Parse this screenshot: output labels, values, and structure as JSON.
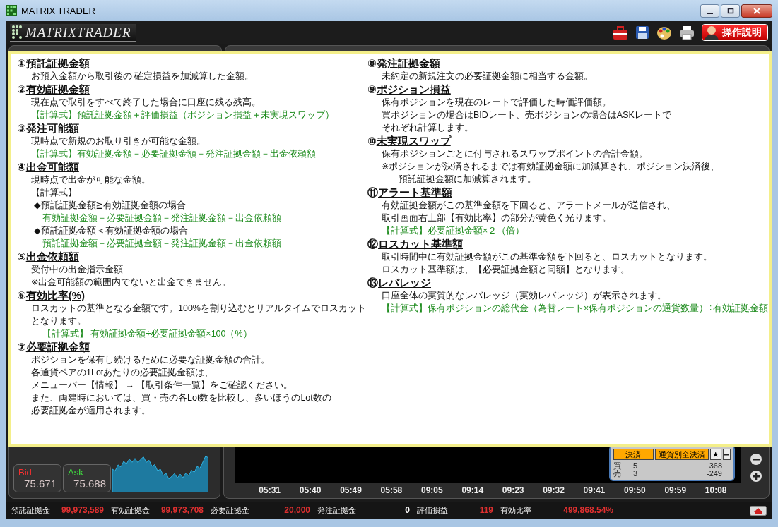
{
  "window": {
    "title": "MATRIX TRADER"
  },
  "header": {
    "logo": "MATRIXTRADER",
    "help_button": "操作説明"
  },
  "help": {
    "columns": [
      [
        {
          "number": "①",
          "title": "預託証拠金額",
          "lines": [
            {
              "kind": "text",
              "text": "お預入金額から取引後の 確定損益を加減算した金額。"
            }
          ]
        },
        {
          "number": "②",
          "title": "有効証拠金額",
          "lines": [
            {
              "kind": "text",
              "text": "現在点で取引をすべて終了した場合に口座に残る残高。"
            },
            {
              "kind": "formula",
              "text": "【計算式】預託証拠金額＋評価損益（ポジション損益＋未実現スワップ）"
            }
          ]
        },
        {
          "number": "③",
          "title": "発注可能額",
          "lines": [
            {
              "kind": "text",
              "text": "現時点で新規のお取り引きが可能な金額。"
            },
            {
              "kind": "formula",
              "text": "【計算式】有効証拠金額－必要証拠金額－発注証拠金額－出金依頼額"
            }
          ]
        },
        {
          "number": "④",
          "title": "出金可能額",
          "lines": [
            {
              "kind": "text",
              "text": "現時点で出金が可能な金額。"
            },
            {
              "kind": "note",
              "text": "【計算式】"
            },
            {
              "kind": "bullet",
              "text": "◆預託証拠金額≧有効証拠金額の場合"
            },
            {
              "kind": "subformula",
              "text": "有効証拠金額－必要証拠金額－発注証拠金額－出金依頼額"
            },
            {
              "kind": "bullet",
              "text": "◆預託証拠金額＜有効証拠金額の場合"
            },
            {
              "kind": "subformula",
              "text": "預託証拠金額－必要証拠金額－発注証拠金額－出金依頼額"
            }
          ]
        },
        {
          "number": "⑤",
          "title": "出金依頼額",
          "lines": [
            {
              "kind": "text",
              "text": "受付中の出金指示金額"
            },
            {
              "kind": "note",
              "text": "※出金可能額の範囲内でないと出金できません。"
            }
          ]
        },
        {
          "number": "⑥",
          "title": "有効比率(%)",
          "lines": [
            {
              "kind": "note",
              "text": "ロスカットの基準となる金額です。100%を割り込むとリアルタイムでロスカット"
            },
            {
              "kind": "note",
              "text": "となります。"
            },
            {
              "kind": "subformula",
              "text": "【計算式】 有効証拠金額÷必要証拠金額×100（%）"
            }
          ]
        },
        {
          "number": "⑦",
          "title": "必要証拠金額",
          "lines": [
            {
              "kind": "text",
              "text": "ポジションを保有し続けるために必要な証拠金額の合計。"
            },
            {
              "kind": "note",
              "text": "各通貨ペアの1Lotあたりの必要証拠金額は、"
            },
            {
              "kind": "note",
              "text": "メニューバー【情報】 → 【取引条件一覧】をご確認ください。"
            },
            {
              "kind": "note",
              "text": "また、両建時においては、買・売の各Lot数を比較し、多いほうのLot数の"
            },
            {
              "kind": "note",
              "text": "必要証拠金が適用されます。"
            }
          ]
        }
      ],
      [
        {
          "number": "⑧",
          "title": "発注証拠金額",
          "lines": [
            {
              "kind": "text",
              "text": "未約定の新規注文の必要証拠金額に相当する金額。"
            }
          ]
        },
        {
          "number": "⑨",
          "title": "ポジション損益",
          "lines": [
            {
              "kind": "text",
              "text": "保有ポジションを現在のレートで評価した時価評価額。"
            },
            {
              "kind": "text",
              "text": "買ポジションの場合はBIDレート、売ポジションの場合はASKレートで"
            },
            {
              "kind": "text",
              "text": "それぞれ計算します。"
            }
          ]
        },
        {
          "number": "⑩",
          "title": "未実現スワップ",
          "lines": [
            {
              "kind": "note",
              "text": "保有ポジションごとに付与されるスワップポイントの合計金額。"
            },
            {
              "kind": "note",
              "text": "※ポジションが決済されるまでは有効証拠金額に加減算され、ポジション決済後、"
            },
            {
              "kind": "continued",
              "text": "預託証拠金額に加減算されます。"
            }
          ]
        },
        {
          "number": "⑪",
          "title": "アラート基準額",
          "lines": [
            {
              "kind": "text",
              "text": "有効証拠金額がこの基準金額を下回ると、アラートメールが送信され、"
            },
            {
              "kind": "note",
              "text": "取引画面右上部【有効比率】の部分が黄色く光ります。"
            },
            {
              "kind": "formula",
              "text": "【計算式】必要証拠金額×２（倍）"
            }
          ]
        },
        {
          "number": "⑫",
          "title": "ロスカット基準額",
          "lines": [
            {
              "kind": "text",
              "text": "取引時間中に有効証拠金額がこの基準金額を下回ると、ロスカットとなります。"
            },
            {
              "kind": "text",
              "text": "ロスカット基準額は、【必要証拠金額と同額】となります。"
            }
          ]
        },
        {
          "number": "⑬",
          "title": "レバレッジ",
          "lines": [
            {
              "kind": "text",
              "text": "口座全体の実質的なレバレッジ（実効レバレッジ）が表示されます。"
            },
            {
              "kind": "formula",
              "text": "【計算式】保有ポジションの総代金（為替レート×保有ポジションの通貨数量）÷有効証拠金額"
            }
          ]
        }
      ]
    ]
  },
  "quote": {
    "bid": {
      "label": "Bid",
      "price": "75.671"
    },
    "ask": {
      "label": "Ask",
      "price": "75.688"
    }
  },
  "chart": {
    "time_labels": [
      "05:31",
      "05:40",
      "05:49",
      "05:58",
      "09:05",
      "09:14",
      "09:23",
      "09:32",
      "09:41",
      "09:50",
      "09:59",
      "10:08"
    ]
  },
  "positions": {
    "buttons": [
      "決済",
      "通貨別全決済",
      "★"
    ],
    "rows": [
      {
        "side": "買",
        "lots": "5",
        "pl": "368"
      },
      {
        "side": "売",
        "lots": "3",
        "pl": "-249"
      }
    ]
  },
  "status_bar": [
    {
      "label": "預託証拠金",
      "value": "99,973,589",
      "color": "#e03030"
    },
    {
      "label": "有効証拠金",
      "value": "99,973,708",
      "color": "#e03030"
    },
    {
      "label": "必要証拠金",
      "value": "20,000",
      "color": "#e03030"
    },
    {
      "label": "発注証拠金",
      "value": "0",
      "color": "#ffffff"
    },
    {
      "label": "評価損益",
      "value": "119",
      "color": "#e03030"
    },
    {
      "label": "有効比率",
      "value": "499,868.54%",
      "color": "#e03030"
    }
  ]
}
